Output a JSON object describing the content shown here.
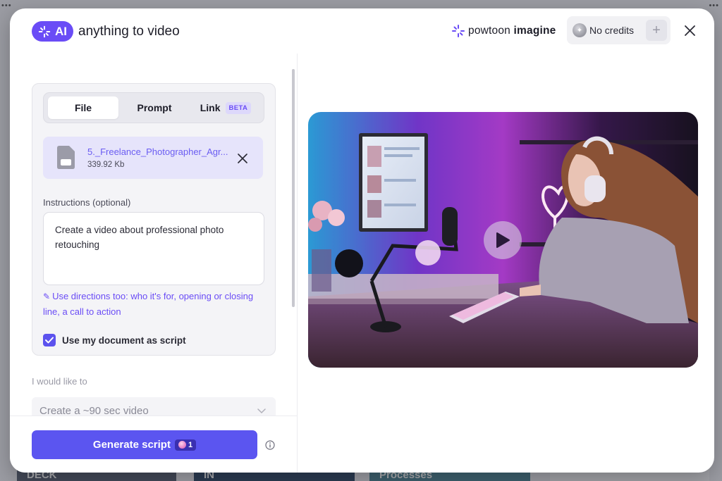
{
  "header": {
    "ai_badge": "AI",
    "title": "anything to video",
    "brand_prefix": "powtoon",
    "brand_suffix": "imagine",
    "credits_label": "No credits",
    "add_credits": "+"
  },
  "source_tabs": [
    {
      "label": "File",
      "active": true
    },
    {
      "label": "Prompt",
      "active": false
    },
    {
      "label": "Link",
      "active": false,
      "badge": "BETA"
    }
  ],
  "file": {
    "name": "5._Freelance_Photographer_Agr...",
    "size": "339.92 Kb"
  },
  "instructions": {
    "label": "Instructions (optional)",
    "value": "Create a video about professional photo retouching",
    "hint": "Use directions too: who it's for, opening or closing line, a call to action",
    "hint_icon": "pencil-icon"
  },
  "use_document_as_script": {
    "label": "Use my document as script",
    "checked": true
  },
  "video_length": {
    "label": "I would like to",
    "selected": "Create a ~90 sec video"
  },
  "generate": {
    "label": "Generate script",
    "cost": "1"
  },
  "colors": {
    "accent": "#6a4cf6",
    "button": "#5b55f0",
    "file_bg": "#e6e4fb"
  },
  "background_cards": [
    "DECK",
    "IN",
    "Processes"
  ]
}
